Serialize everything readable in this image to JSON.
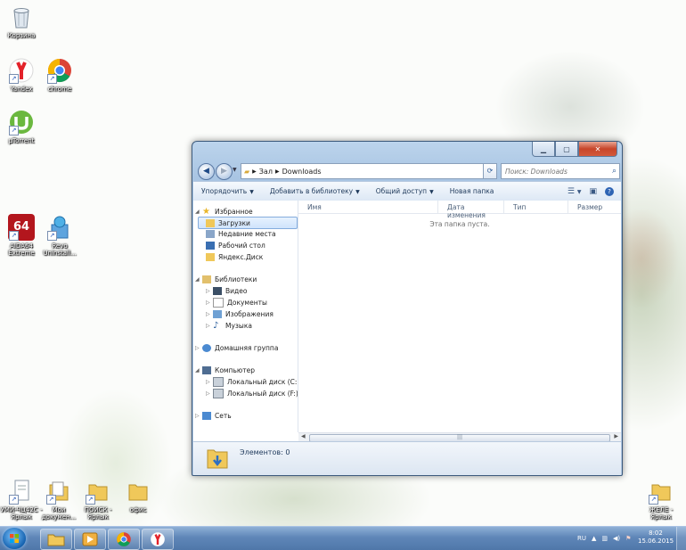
{
  "desktop_icons": [
    {
      "id": "recycle",
      "label": "Корзина",
      "icon": "recycle-bin-icon"
    },
    {
      "id": "yandex",
      "label": "Yandex",
      "icon": "yandex-browser-icon"
    },
    {
      "id": "chrome",
      "label": "chrome",
      "icon": "chrome-icon"
    },
    {
      "id": "utorrent",
      "label": "µTorrent",
      "icon": "utorrent-icon"
    },
    {
      "id": "aida",
      "label": "AIDA64 Extreme",
      "icon": "aida64-icon"
    },
    {
      "id": "revo",
      "label": "Revo Uninstall...",
      "icon": "revo-uninstaller-icon"
    },
    {
      "id": "s1",
      "label": "УМИ-ЧЦ42С - Ярлык",
      "icon": "document-shortcut-icon"
    },
    {
      "id": "s2",
      "label": "Мои докумен...",
      "icon": "folder-shortcut-icon"
    },
    {
      "id": "s3",
      "label": "ПОИСК - Ярлык",
      "icon": "folder-shortcut-icon"
    },
    {
      "id": "s4",
      "label": "офис",
      "icon": "folder-icon"
    },
    {
      "id": "s5",
      "label": "ЖЕЛЕ - Ярлык",
      "icon": "folder-shortcut-icon"
    }
  ],
  "window": {
    "path": [
      "Зал",
      "Downloads"
    ],
    "search_placeholder": "Поиск: Downloads",
    "toolbar": [
      "Упорядочить",
      "Добавить в библиотеку",
      "Общий доступ",
      "Новая папка"
    ],
    "nav": {
      "favorites_header": "Избранное",
      "favorites": [
        "Загрузки",
        "Недавние места",
        "Рабочий стол",
        "Яндекс.Диск"
      ],
      "libraries_header": "Библиотеки",
      "libraries": [
        "Видео",
        "Документы",
        "Изображения",
        "Музыка"
      ],
      "homegroup": "Домашняя группа",
      "computer_header": "Компьютер",
      "drives": [
        "Локальный диск (C:)",
        "Локальный диск (F:)"
      ],
      "network": "Сеть"
    },
    "columns": [
      "Имя",
      "Дата изменения",
      "Тип",
      "Размер"
    ],
    "empty_text": "Эта папка пуста.",
    "status": "Элементов: 0"
  },
  "taskbar": {
    "apps": [
      "explorer-icon",
      "media-player-icon",
      "chrome-icon",
      "yandex-browser-icon"
    ],
    "lang": "RU",
    "time": "8:02",
    "date": "15.06.2015"
  }
}
